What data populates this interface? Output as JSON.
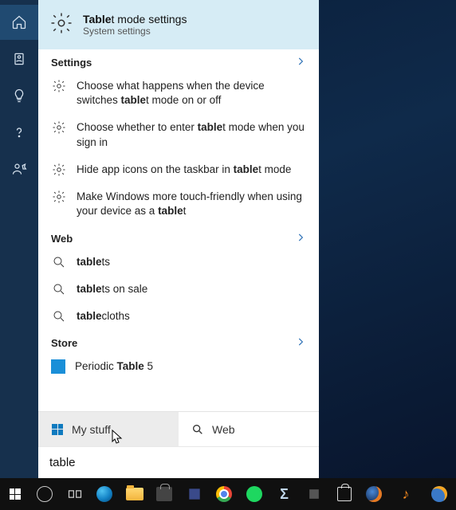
{
  "query": "table",
  "best_match": {
    "title_pre": "Table",
    "title_post": "t mode settings",
    "subtitle": "System settings"
  },
  "sections": {
    "settings": {
      "label": "Settings",
      "items": [
        {
          "pre": "Choose what happens when the device switches ",
          "bold": "table",
          "post": "t mode on or off"
        },
        {
          "pre": "Choose whether to enter ",
          "bold": "table",
          "post": "t mode when you sign in"
        },
        {
          "pre": "Hide app icons on the taskbar in ",
          "bold": "table",
          "post": "t mode"
        },
        {
          "pre": "Make Windows more touch-friendly when using your device as a ",
          "bold": "table",
          "post": "t"
        }
      ]
    },
    "web": {
      "label": "Web",
      "items": [
        {
          "pre": "",
          "bold": "table",
          "post": "ts"
        },
        {
          "pre": "",
          "bold": "table",
          "post": "ts on sale"
        },
        {
          "pre": "",
          "bold": "table",
          "post": "cloths"
        }
      ]
    },
    "store": {
      "label": "Store",
      "items": [
        {
          "pre": "Periodic ",
          "bold": "Table",
          "post": " 5"
        }
      ]
    }
  },
  "tabs": {
    "mystuff": "My stuff",
    "web": "Web"
  }
}
